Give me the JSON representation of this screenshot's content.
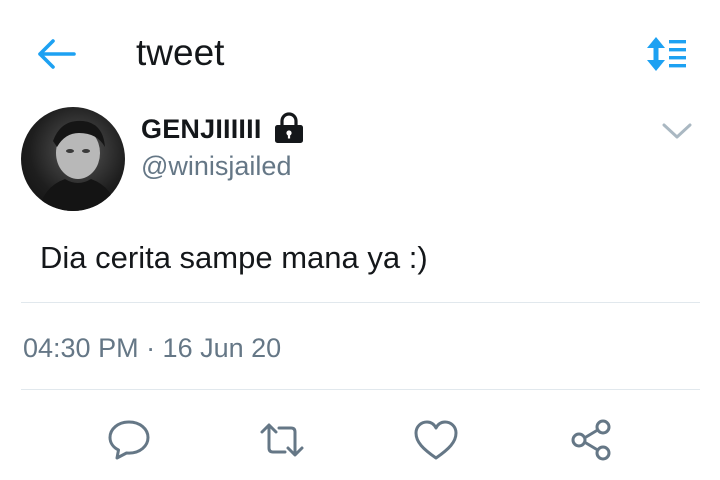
{
  "header": {
    "title": "tweet",
    "back_icon": "arrow-left-icon",
    "sort_icon": "sort-toggle-icon",
    "accent_color": "#1da1f2"
  },
  "tweet": {
    "display_name": "GENJIIIIII",
    "protected_icon": "lock-icon",
    "username": "@winisjailed",
    "text": "Dia cerita sampe mana ya :)",
    "timestamp": "04:30 PM · 16 Jun 20"
  },
  "actions": [
    {
      "name": "reply",
      "icon": "speech-bubble-icon"
    },
    {
      "name": "retweet",
      "icon": "retweet-icon"
    },
    {
      "name": "like",
      "icon": "heart-icon"
    },
    {
      "name": "share",
      "icon": "share-icon"
    }
  ],
  "colors": {
    "text_primary": "#14171a",
    "text_secondary": "#657786",
    "icon_gray": "#657786",
    "divider": "#e1e8ed"
  }
}
